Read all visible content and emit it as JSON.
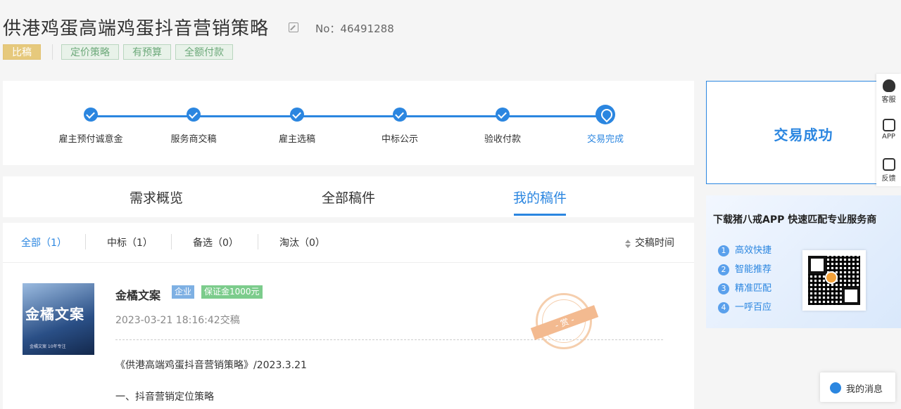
{
  "header": {
    "title": "供港鸡蛋高端鸡蛋抖音营销策略",
    "no_label": "No：46491288",
    "tags": [
      "比稿",
      "定价策略",
      "有预算",
      "全额付款"
    ]
  },
  "progress": {
    "steps": [
      "雇主预付诚意金",
      "服务商交稿",
      "雇主选稿",
      "中标公示",
      "验收付款",
      "交易完成"
    ]
  },
  "status": {
    "label": "交易成功"
  },
  "side_tools": [
    "客服",
    "APP",
    "反馈"
  ],
  "app_ad": {
    "title": "下载猪八戒APP 快速匹配专业服务商",
    "items": [
      "高效快捷",
      "智能推荐",
      "精准匹配",
      "一呼百应"
    ],
    "nums": [
      "1",
      "2",
      "3",
      "4"
    ]
  },
  "tabs": [
    "需求概览",
    "全部稿件",
    "我的稿件"
  ],
  "filters": {
    "items": [
      "全部（1）",
      "中标（1）",
      "备选（0）",
      "淘汰（0）"
    ],
    "sort_label": "交稿时间"
  },
  "submission": {
    "thumb_title": "金橘文案",
    "thumb_sub": "金橘文案 10年专注",
    "company": "金橘文案",
    "badge_type": "企业",
    "badge_deposit": "保证金1000元",
    "date": "2023-03-21 18:16:42交稿",
    "stamp_text": "- 赏 -",
    "line1": "《供港高端鸡蛋抖音营销策略》/2023.3.21",
    "line2": "一、抖音营销定位策略"
  },
  "message_btn": {
    "label": "我的消息"
  }
}
